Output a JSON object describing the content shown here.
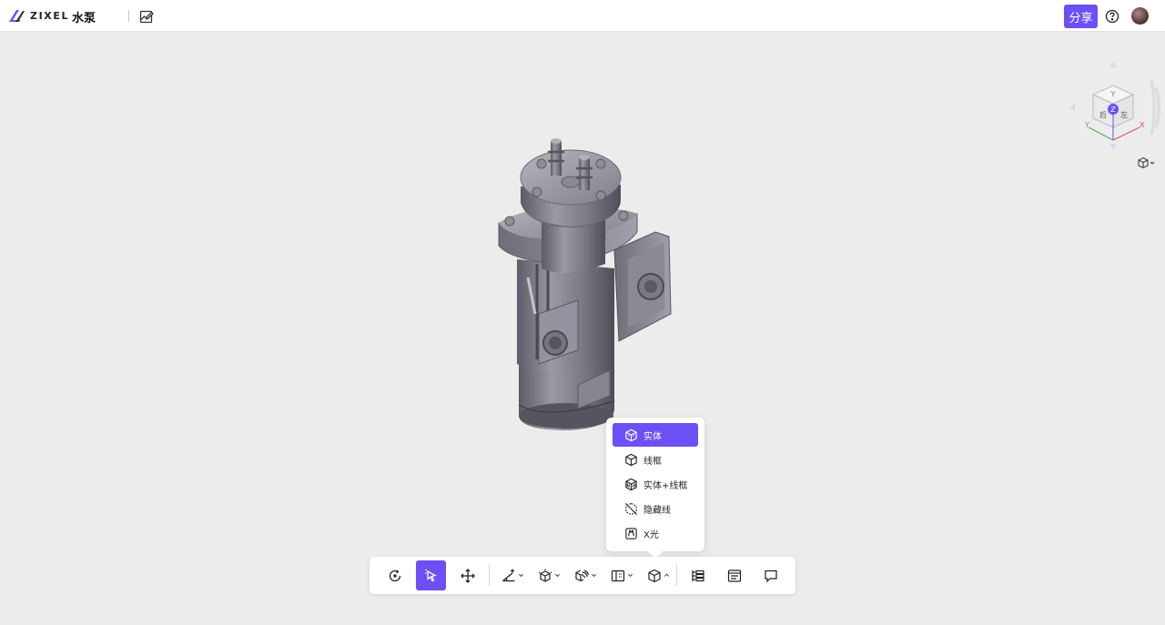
{
  "header": {
    "logo_text": "ZIXEL",
    "doc_title": "水泵",
    "share_label": "分享"
  },
  "viewcube": {
    "faces": {
      "top": "Z",
      "front": "后",
      "right": "左",
      "back": "Y"
    },
    "axes": {
      "x": "X",
      "y": "Y",
      "z": "Z"
    }
  },
  "render_menu": {
    "items": [
      {
        "label": "实体",
        "icon": "solid-cube-icon",
        "selected": true
      },
      {
        "label": "线框",
        "icon": "wireframe-cube-icon",
        "selected": false
      },
      {
        "label": "实体+线框",
        "icon": "solid-wireframe-icon",
        "selected": false
      },
      {
        "label": "隐藏线",
        "icon": "hidden-line-icon",
        "selected": false
      },
      {
        "label": "X光",
        "icon": "xray-icon",
        "selected": false
      }
    ]
  },
  "toolbar": {
    "tools": [
      {
        "name": "rotate",
        "icon": "rotate-icon"
      },
      {
        "name": "select",
        "icon": "select-cursor-icon",
        "active": true
      },
      {
        "name": "pan",
        "icon": "pan-move-icon"
      },
      {
        "name": "measure",
        "icon": "measure-icon",
        "dropdown": true
      },
      {
        "name": "explode",
        "icon": "explode-icon",
        "dropdown": true
      },
      {
        "name": "section",
        "icon": "section-icon",
        "dropdown": true
      },
      {
        "name": "view",
        "icon": "view-icon",
        "dropdown": true
      },
      {
        "name": "render-mode",
        "icon": "cube-icon",
        "dropdown": true,
        "expanded": true
      },
      {
        "name": "model-tree",
        "icon": "tree-icon"
      },
      {
        "name": "properties",
        "icon": "properties-icon"
      },
      {
        "name": "comments",
        "icon": "comment-icon"
      }
    ]
  },
  "colors": {
    "accent": "#6c4ff5",
    "canvas_bg": "#ececec",
    "model_gray": "#8a8a94"
  }
}
